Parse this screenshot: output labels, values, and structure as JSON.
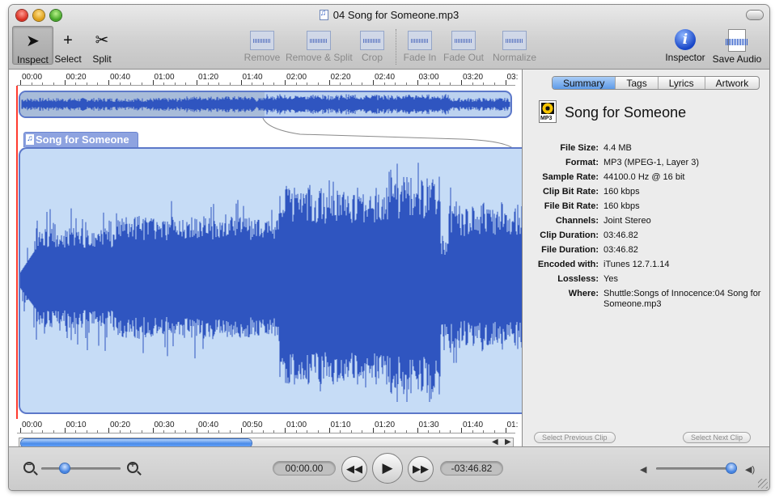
{
  "window": {
    "title": "04 Song for Someone.mp3"
  },
  "toolbar": {
    "inspect": "Inspect",
    "select": "Select",
    "split": "Split",
    "remove": "Remove",
    "remove_split": "Remove & Split",
    "crop": "Crop",
    "fade_in": "Fade In",
    "fade_out": "Fade Out",
    "normalize": "Normalize",
    "inspector": "Inspector",
    "save_audio": "Save Audio"
  },
  "top_ruler": {
    "labels": [
      "00:00",
      "00:20",
      "00:40",
      "01:00",
      "01:20",
      "01:40",
      "02:00",
      "02:20",
      "02:40",
      "03:00",
      "03:20",
      "03:"
    ]
  },
  "clip": {
    "name": "Song for Someone"
  },
  "bottom_ruler": {
    "labels": [
      "00:00",
      "00:10",
      "00:20",
      "00:30",
      "00:40",
      "00:50",
      "01:00",
      "01:10",
      "01:20",
      "01:30",
      "01:40",
      "01:"
    ]
  },
  "scroll": {
    "left_arrow": "◀",
    "right_arrow": "▶"
  },
  "inspector": {
    "tabs": [
      "Summary",
      "Tags",
      "Lyrics",
      "Artwork"
    ],
    "active_tab": "Summary",
    "title": "Song for Someone",
    "file_icon_label": "MP3",
    "properties": [
      {
        "key": "File Size:",
        "value": "4.4 MB"
      },
      {
        "key": "Format:",
        "value": "MP3 (MPEG-1, Layer 3)"
      },
      {
        "key": "Sample Rate:",
        "value": "44100.0 Hz @ 16 bit"
      },
      {
        "key": "Clip Bit Rate:",
        "value": "160 kbps"
      },
      {
        "key": "File Bit Rate:",
        "value": "160 kbps"
      },
      {
        "key": "Channels:",
        "value": "Joint Stereo"
      },
      {
        "key": "Clip Duration:",
        "value": "03:46.82"
      },
      {
        "key": "File Duration:",
        "value": "03:46.82"
      },
      {
        "key": "Encoded with:",
        "value": "iTunes 12.7.1.14"
      },
      {
        "key": "Lossless:",
        "value": "Yes"
      },
      {
        "key": "Where:",
        "value": "Shuttle:Songs of Innocence:04 Song for Someone.mp3"
      }
    ],
    "prev_clip": "Select Previous Clip",
    "next_clip": "Select Next Clip"
  },
  "transport": {
    "elapsed": "00:00.00",
    "remaining": "-03:46.82",
    "zoom_level": 0.3,
    "volume_level": 0.95
  },
  "colors": {
    "waveform": "#2f55c0",
    "clip_background": "#c6dcf6",
    "playhead": "#ff3b30",
    "accent": "#5f9be8"
  }
}
